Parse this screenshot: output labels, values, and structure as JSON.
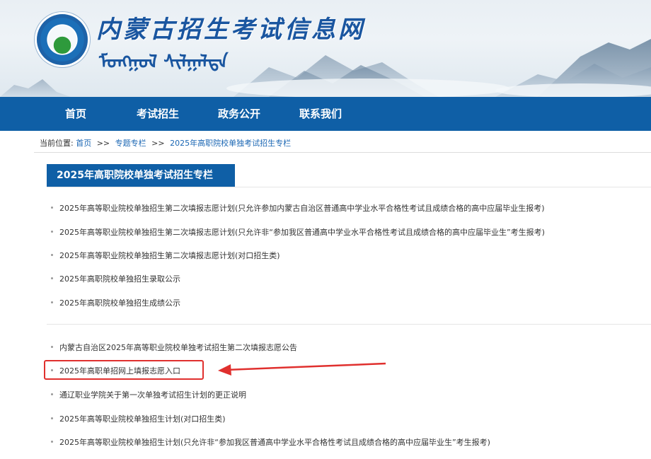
{
  "header": {
    "site_title": "内蒙古招生考试信息网",
    "mongolian_subtitle": "ᠮᠣᠩᠭᠣᠯ ᠰᠢᠯᠭᠠᠯᠲᠠ"
  },
  "nav": {
    "items": [
      {
        "label": "首页"
      },
      {
        "label": "考试招生"
      },
      {
        "label": "政务公开"
      },
      {
        "label": "联系我们"
      }
    ]
  },
  "breadcrumb": {
    "prefix": "当前位置:",
    "crumbs": [
      "首页",
      "专题专栏",
      "2025年高职院校单独考试招生专栏"
    ],
    "separator": ">>"
  },
  "section": {
    "title": "2025年高职院校单独考试招生专栏"
  },
  "news": {
    "group1": [
      "2025年高等职业院校单独招生第二次填报志愿计划(只允许参加内蒙古自治区普通高中学业水平合格性考试且成绩合格的高中应届毕业生报考)",
      "2025年高等职业院校单独招生第二次填报志愿计划(只允许非“参加我区普通高中学业水平合格性考试且成绩合格的高中应届毕业生”考生报考)",
      "2025年高等职业院校单独招生第二次填报志愿计划(对口招生类)",
      "2025年高职院校单独招生录取公示",
      "2025年高职院校单独招生成绩公示"
    ],
    "group2": [
      "内蒙古自治区2025年高等职业院校单独考试招生第二次填报志愿公告",
      "2025年高职单招网上填报志愿入口",
      "通辽职业学院关于第一次单独考试招生计划的更正说明",
      "2025年高等职业院校单独招生计划(对口招生类)",
      "2025年高等职业院校单独招生计划(只允许非“参加我区普通高中学业水平合格性考试且成绩合格的高中应届毕业生”考生报考)"
    ]
  },
  "colors": {
    "brand_blue": "#0f5fa6",
    "link_blue": "#1a66b3",
    "annotation_red": "#e0302e"
  }
}
